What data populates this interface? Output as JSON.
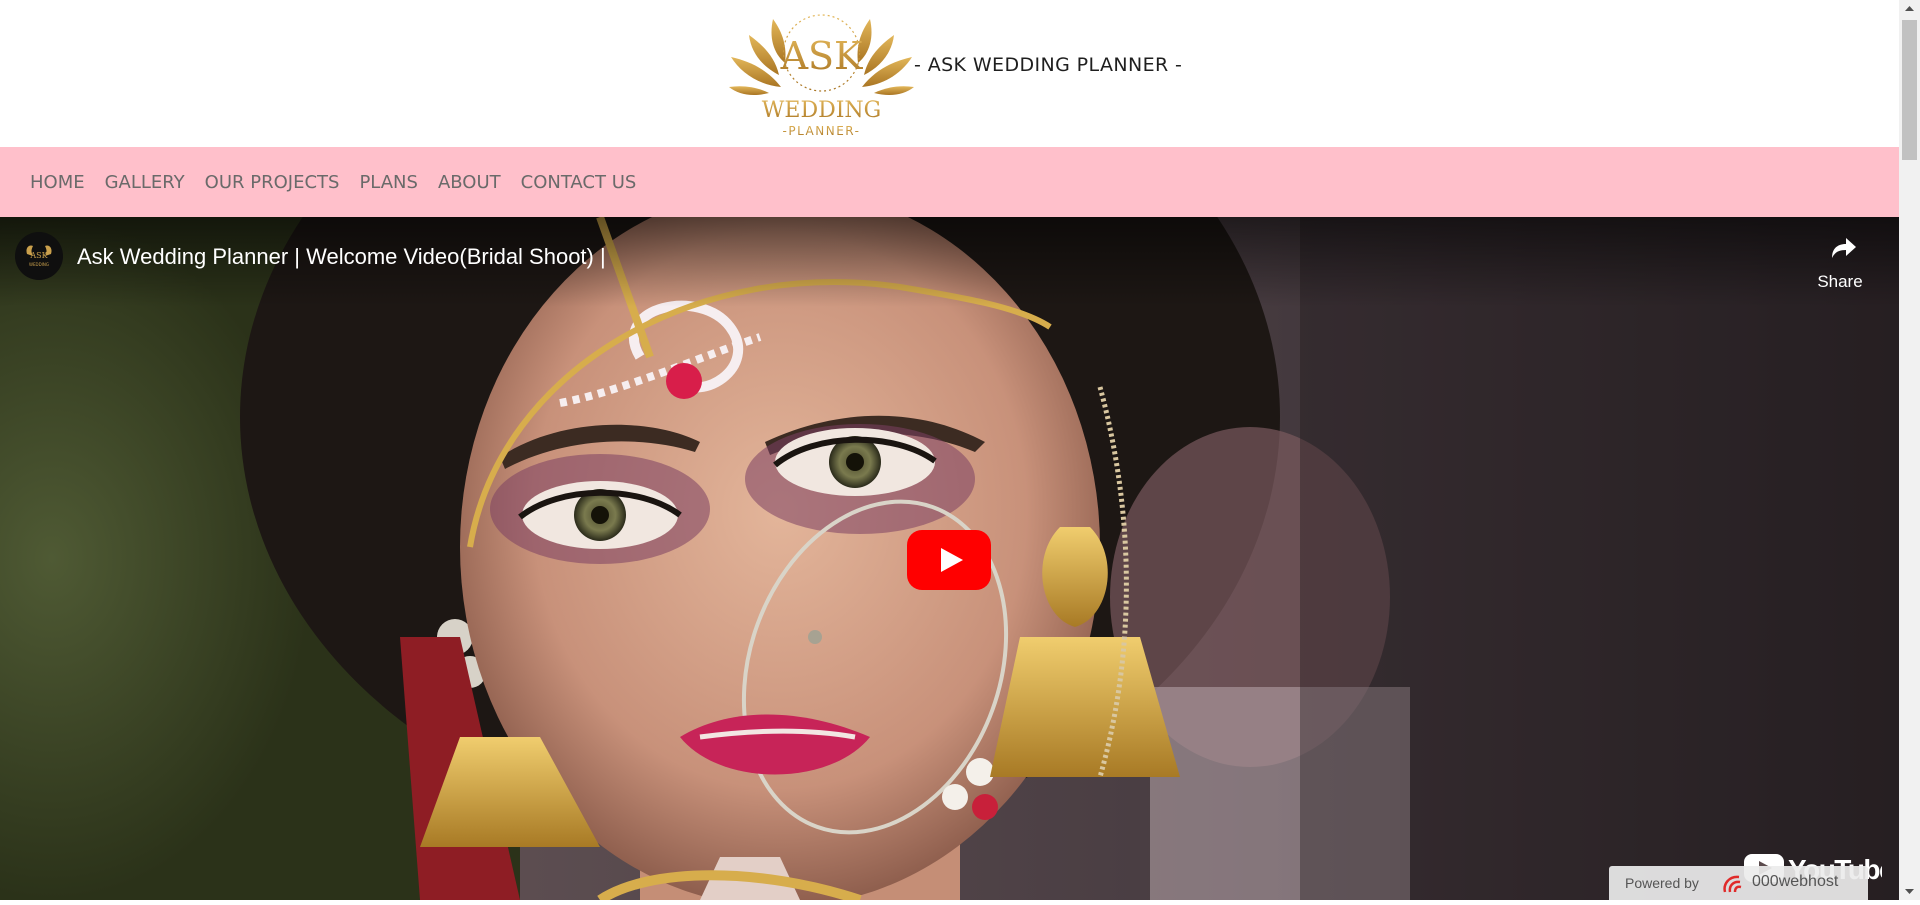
{
  "header": {
    "logo": {
      "line1": "ASK",
      "line2": "WEDDING",
      "line3": "-PLANNER-"
    },
    "brand_text": "- ASK WEDDING PLANNER -"
  },
  "nav": {
    "items": [
      {
        "label": "HOME"
      },
      {
        "label": "GALLERY"
      },
      {
        "label": "OUR PROJECTS"
      },
      {
        "label": "PLANS"
      },
      {
        "label": "ABOUT"
      },
      {
        "label": "CONTACT US"
      }
    ]
  },
  "video": {
    "title": "Ask Wedding Planner | Welcome Video(Bridal Shoot) |",
    "share_label": "Share",
    "youtube_label": "YouTube",
    "powered_by": "Powered by",
    "host_name": "000webhost"
  },
  "colors": {
    "nav_bg": "#ffc0cb",
    "gold": "#c8973a",
    "play_red": "#ff0000"
  }
}
